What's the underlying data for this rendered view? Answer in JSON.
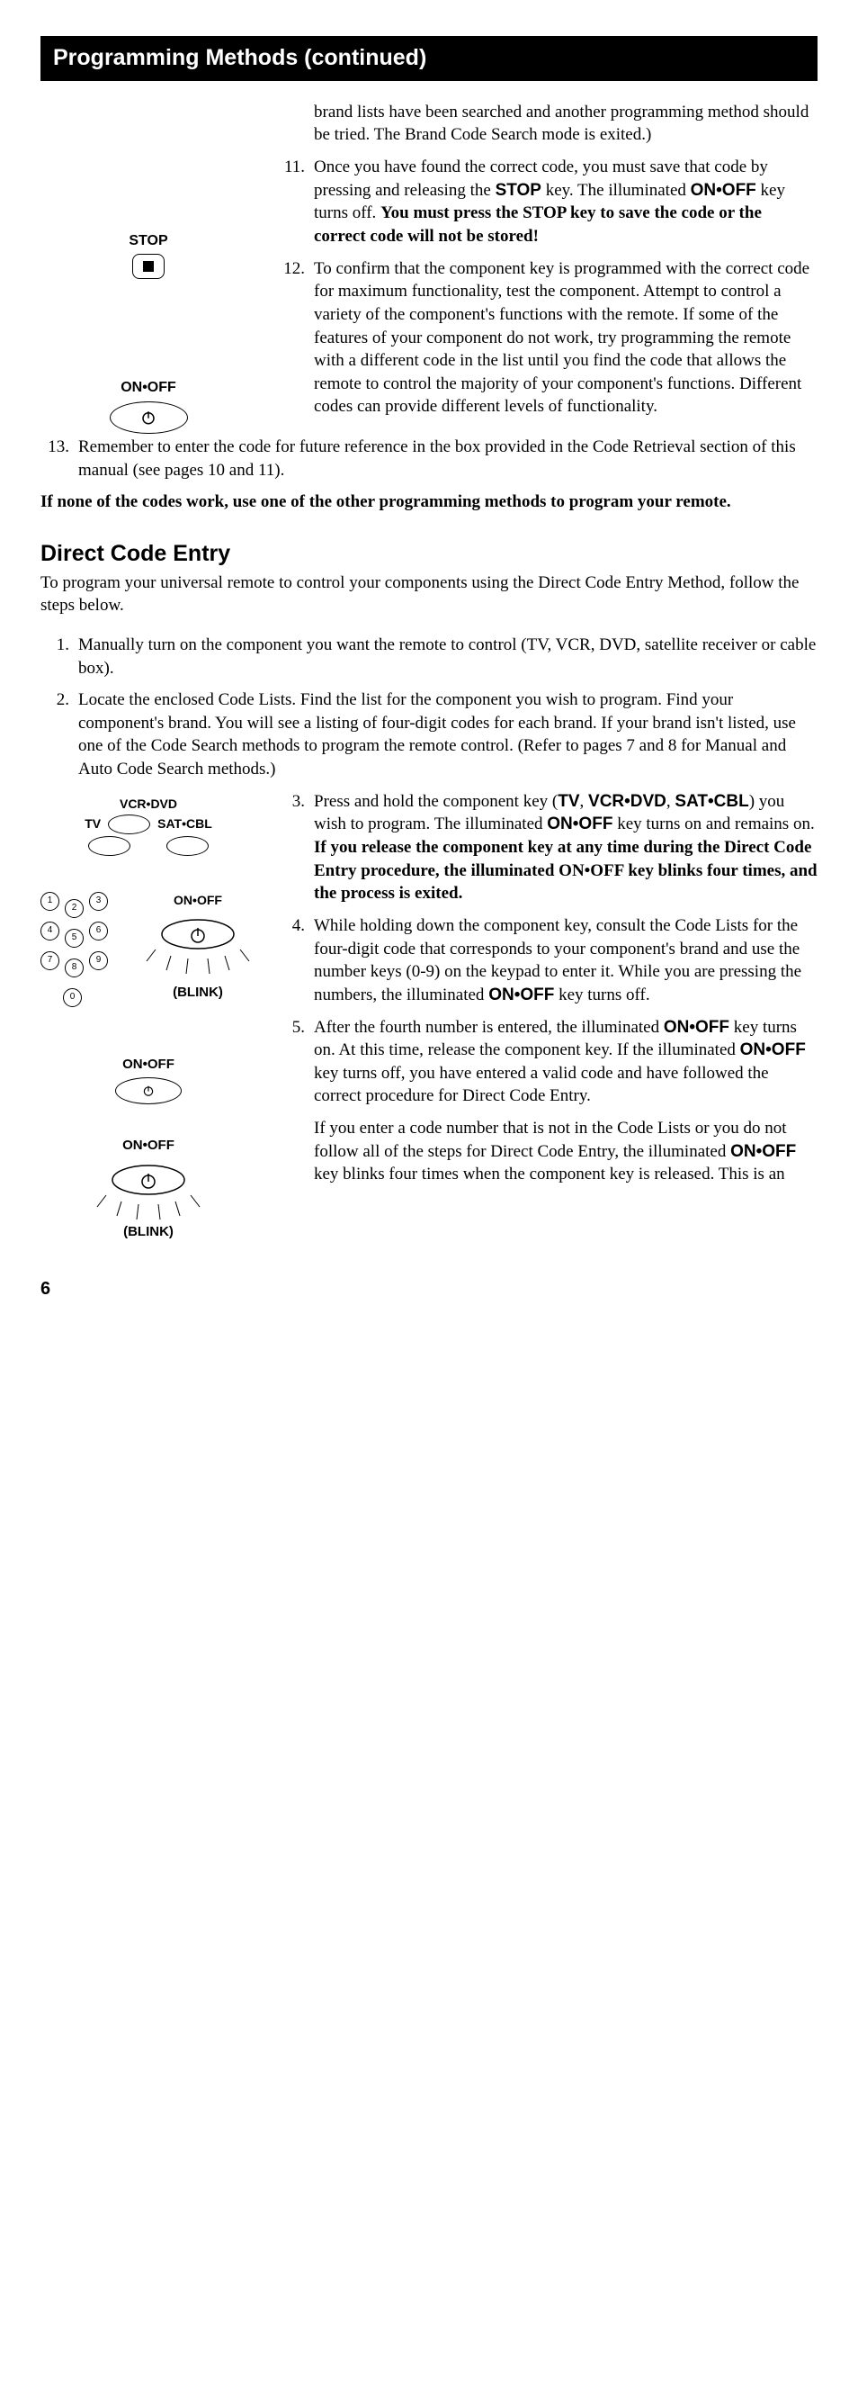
{
  "header": "Programming Methods (continued)",
  "icons": {
    "stop": "STOP",
    "onoff": "ON•OFF",
    "blink": "(BLINK)",
    "tv": "TV",
    "vcr_dvd": "VCR•DVD",
    "sat_cbl": "SAT•CBL"
  },
  "top": {
    "intro_fragment": "brand lists have been searched and another programming method should be tried. The Brand Code Search mode is exited.)",
    "item11_num": "11.",
    "item11_a": "Once you have found the correct code, you must save that code by pressing and releasing the ",
    "item11_b": " key. The illuminated ",
    "item11_c": " key turns off. ",
    "item11_bold": "You must press the STOP key to save the code or the correct code will not be stored!",
    "item12_num": "12.",
    "item12": "To confirm that the component key is programmed with the correct code for maximum functionality, test the component. Attempt to control a variety of the component's functions with the remote. If some of the features of your component do not work, try programming the remote with a different code in the list until you find the code that allows the remote to control the majority of your component's functions. Different codes can provide different levels of functionality.",
    "item13_num": "13.",
    "item13": "Remember to enter the code for future reference in the box provided in the Code Retrieval section of this manual (see pages 10 and 11).",
    "note": "If none of the codes work, use one of the other programming methods to program your remote."
  },
  "direct": {
    "heading": "Direct Code Entry",
    "lead": "To program your universal remote to control your components using the Direct Code Entry Method, follow the steps below.",
    "s1_num": "1.",
    "s1": "Manually turn on the component you want the remote to control (TV, VCR, DVD, satellite receiver or cable box).",
    "s2_num": "2.",
    "s2": "Locate the enclosed Code Lists. Find the list for the component you wish to program. Find your component's brand. You will see a listing of four-digit codes for each brand. If your brand isn't listed, use one of the Code Search methods to program the remote control. (Refer to pages 7 and 8 for Manual and Auto Code Search methods.)",
    "s3_num": "3.",
    "s3_a": "Press and hold the component key (",
    "s3_b": ") you wish to program. The illuminated ",
    "s3_c": " key turns on and remains on. ",
    "s3_bold": "If you release the component key at any time during the Direct Code Entry procedure, the illuminated ON•OFF key blinks four times, and the process is exited.",
    "tv_key": "TV",
    "vcr_key": "VCR•DVD",
    "sat_key": "SAT•CBL",
    "comma": ", ",
    "s4_num": "4.",
    "s4_a": "While holding down the component key, consult the Code Lists for the four-digit code that corresponds to your component's brand and use the number keys (0-9) on the keypad to enter it. While you are pressing the numbers, the illuminated ",
    "s4_b": " key turns off.",
    "s5_num": "5.",
    "s5_a": "After the fourth number is entered, the illuminated ",
    "s5_b": " key turns on. At this time, release the component key. If the illuminated ",
    "s5_c": " key turns off, you have entered a valid code and have followed the correct procedure for Direct Code Entry.",
    "s5_cont_a": "If you enter a code number that is not in the Code Lists or you do not follow all of the steps for Direct Code Entry, the illuminated ",
    "s5_cont_b": " key blinks four times when the component key is released. This is an"
  },
  "page_number": "6"
}
